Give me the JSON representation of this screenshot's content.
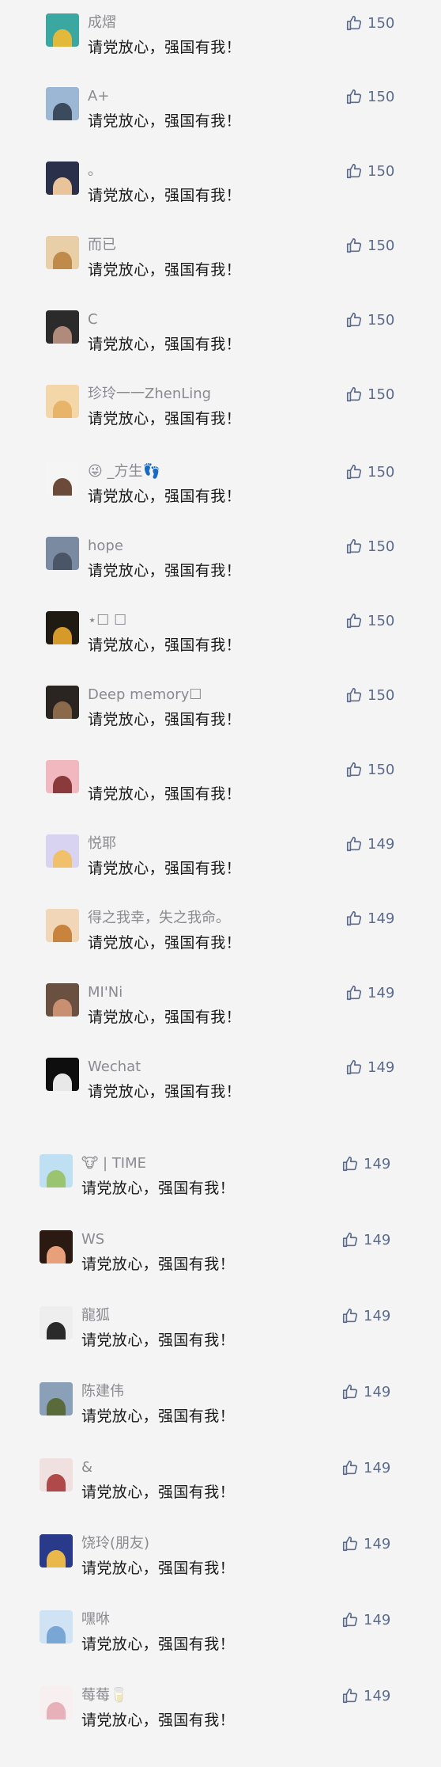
{
  "comments": [
    {
      "nick": "成熠",
      "text": "请党放心，强国有我！",
      "likes": "150",
      "avatar_colors": [
        "#3aa7a0",
        "#e2b93b"
      ]
    },
    {
      "nick": "A+",
      "text": "请党放心，强国有我！",
      "likes": "150",
      "avatar_colors": [
        "#9bb7d4",
        "#3b4a5c"
      ]
    },
    {
      "nick": "。",
      "text": "请党放心，强国有我！",
      "likes": "150",
      "avatar_colors": [
        "#2a2f4a",
        "#e9c39a"
      ]
    },
    {
      "nick": "而已",
      "text": "请党放心，强国有我！",
      "likes": "150",
      "avatar_colors": [
        "#e8cfa8",
        "#c08a4a"
      ]
    },
    {
      "nick": "C",
      "text": "请党放心，强国有我！",
      "likes": "150",
      "avatar_colors": [
        "#2b2b2b",
        "#b08a7a"
      ]
    },
    {
      "nick": "珍玲一一ZhenLing",
      "text": "请党放心，强国有我！",
      "likes": "150",
      "avatar_colors": [
        "#f3d7a8",
        "#e7b46a"
      ]
    },
    {
      "nick": "😜 _方生👣",
      "text": "请党放心，强国有我！",
      "likes": "150",
      "avatar_colors": [
        "#f5f5f5",
        "#6b4a3a"
      ]
    },
    {
      "nick": "hope",
      "text": "请党放心，强国有我！",
      "likes": "150",
      "avatar_colors": [
        "#7a8aa0",
        "#4a5568"
      ]
    },
    {
      "nick": "⋆☐ ☐",
      "text": "请党放心，强国有我！",
      "likes": "150",
      "avatar_colors": [
        "#1f1a12",
        "#d69a2a"
      ]
    },
    {
      "nick": "Deep memory☐",
      "text": "请党放心，强国有我！",
      "likes": "150",
      "avatar_colors": [
        "#2a2520",
        "#8a6a4a"
      ]
    },
    {
      "nick": "",
      "text": "请党放心，强国有我！",
      "likes": "150",
      "avatar_colors": [
        "#f2b8c0",
        "#8a3a3a"
      ]
    },
    {
      "nick": "悦耶",
      "text": "请党放心，强国有我！",
      "likes": "149",
      "avatar_colors": [
        "#d7d3f0",
        "#f0c06a"
      ]
    },
    {
      "nick": "得之我幸，失之我命。",
      "text": "请党放心，强国有我！",
      "likes": "149",
      "avatar_colors": [
        "#f1d7b8",
        "#c8843c"
      ]
    },
    {
      "nick": "MI'Ni",
      "text": "请党放心，强国有我！",
      "likes": "149",
      "avatar_colors": [
        "#6a5040",
        "#c89070"
      ]
    },
    {
      "nick": "Wechat",
      "text": "请党放心，强国有我！",
      "likes": "149",
      "avatar_colors": [
        "#0e0e0e",
        "#e8e8e8"
      ]
    },
    {
      "nick": "🐮 | TIME",
      "text": "请党放心，强国有我！",
      "likes": "149",
      "avatar_colors": [
        "#bfe0f2",
        "#9ac470"
      ]
    },
    {
      "nick": "WS",
      "text": "请党放心，强国有我！",
      "likes": "149",
      "avatar_colors": [
        "#2a1a12",
        "#e8a07a"
      ]
    },
    {
      "nick": "龍狐",
      "text": "请党放心，强国有我！",
      "likes": "149",
      "avatar_colors": [
        "#eeeeee",
        "#2a2a2a"
      ]
    },
    {
      "nick": "陈建伟",
      "text": "请党放心，强国有我！",
      "likes": "149",
      "avatar_colors": [
        "#8aa0b8",
        "#5a6a3a"
      ]
    },
    {
      "nick": "&",
      "text": "请党放心，强国有我！",
      "likes": "149",
      "avatar_colors": [
        "#f0e0e0",
        "#b04a4a"
      ]
    },
    {
      "nick": "饶玲(朋友)",
      "text": "请党放心，强国有我！",
      "likes": "149",
      "avatar_colors": [
        "#2a3a8a",
        "#e8b84a"
      ]
    },
    {
      "nick": "嘿咻",
      "text": "请党放心，强国有我！",
      "likes": "149",
      "avatar_colors": [
        "#cfe3f4",
        "#7aa6d6"
      ]
    },
    {
      "nick": "莓莓🥛",
      "text": "请党放心，强国有我！",
      "likes": "149",
      "avatar_colors": [
        "#f8f0f0",
        "#e8b0b8"
      ]
    }
  ]
}
